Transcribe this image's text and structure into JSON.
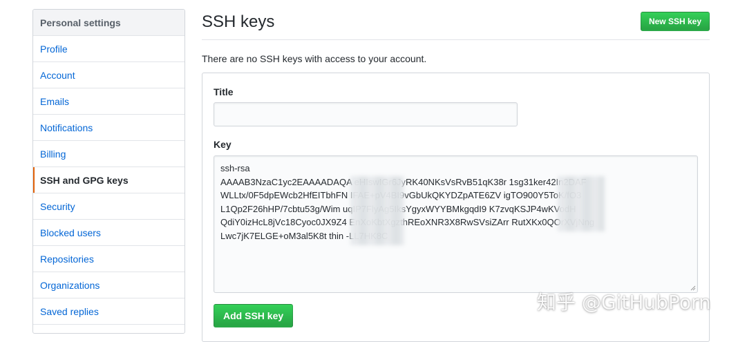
{
  "sidebar": {
    "header": "Personal settings",
    "items": [
      {
        "label": "Profile"
      },
      {
        "label": "Account"
      },
      {
        "label": "Emails"
      },
      {
        "label": "Notifications"
      },
      {
        "label": "Billing"
      },
      {
        "label": "SSH and GPG keys",
        "selected": true
      },
      {
        "label": "Security"
      },
      {
        "label": "Blocked users"
      },
      {
        "label": "Repositories"
      },
      {
        "label": "Organizations"
      },
      {
        "label": "Saved replies"
      }
    ]
  },
  "main": {
    "title": "SSH keys",
    "new_key_button": "New SSH key",
    "empty_message": "There are no SSH keys with access to your account.",
    "form": {
      "title_label": "Title",
      "title_value": "",
      "key_label": "Key",
      "key_lines": [
        "ssh-rsa",
        "AAAAB3NzaC1yc2EAAAADAQA                    eHIswIGr6JyRK40NKsVsRvB51qK38r                    1sg31ker42In2DAF",
        "WLLtx/0F5dpEWcb2HfEITbhFN                    IFAE+pV4BI9vGbUkQKYDZpATE6ZV                    igTO900Y5ToK/fO3",
        "L1Qp2F26hHP/7cbtu53g/Wim                    uqIP7FlyAg5IksYgyxWYYBMkgqdI9                    K7zvqKSJP4wKVodH",
        "QdiY0izHcL8jVc18Cyoc0JX9Z4                    EnXoKbtXgzthREoXNR3X8RwSVsiZArr                    RutXKx0QOrXVjNng",
        "Lwc7jK7ELGE+oM3al5K8t thin                    -LL7HK8C"
      ],
      "submit_button": "Add SSH key"
    }
  },
  "watermark": "知乎 @GitHubPorn",
  "colors": {
    "accent_selected": "#e36209",
    "link": "#0366d6",
    "button_green": "#28a745"
  }
}
